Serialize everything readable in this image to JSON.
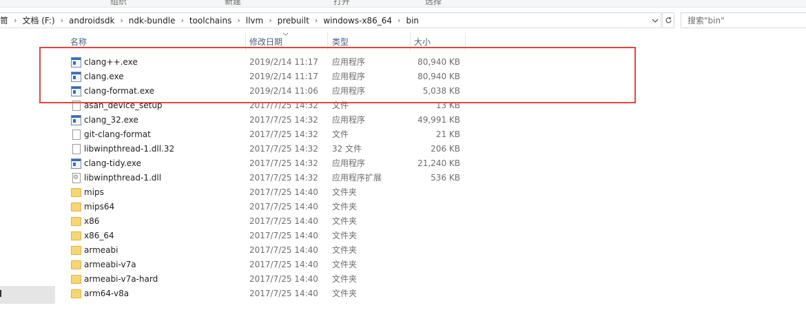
{
  "ribbon": {
    "labels": [
      "组织",
      "新建",
      "打开",
      "选择"
    ]
  },
  "address": {
    "breadcrumbs": [
      "笥",
      "文档 (F:)",
      "androidsdk",
      "ndk-bundle",
      "toolchains",
      "llvm",
      "prebuilt",
      "windows-x86_64",
      "bin"
    ],
    "separator": "›",
    "dropdown_icon": "chevron-down-icon",
    "refresh_icon": "refresh-icon"
  },
  "search": {
    "placeholder": "搜索\"bin\""
  },
  "columns": {
    "name": "名称",
    "date": "修改日期",
    "type": "类型",
    "size": "大小"
  },
  "files": [
    {
      "name": "clang++.exe",
      "date": "2019/2/14 11:17",
      "type": "应用程序",
      "size": "80,940 KB",
      "icon": "exe-icon"
    },
    {
      "name": "clang.exe",
      "date": "2019/2/14 11:17",
      "type": "应用程序",
      "size": "80,940 KB",
      "icon": "exe-icon"
    },
    {
      "name": "clang-format.exe",
      "date": "2019/2/14 11:06",
      "type": "应用程序",
      "size": "5,038 KB",
      "icon": "exe-icon"
    },
    {
      "name": "asan_device_setup",
      "date": "2017/7/25 14:32",
      "type": "文件",
      "size": "13 KB",
      "icon": "file-icon"
    },
    {
      "name": "clang_32.exe",
      "date": "2017/7/25 14:32",
      "type": "应用程序",
      "size": "49,991 KB",
      "icon": "exe-icon"
    },
    {
      "name": "git-clang-format",
      "date": "2017/7/25 14:32",
      "type": "文件",
      "size": "21 KB",
      "icon": "file-icon"
    },
    {
      "name": "libwinpthread-1.dll.32",
      "date": "2017/7/25 14:32",
      "type": "32 文件",
      "size": "206 KB",
      "icon": "file-icon"
    },
    {
      "name": "clang-tidy.exe",
      "date": "2017/7/25 14:32",
      "type": "应用程序",
      "size": "21,240 KB",
      "icon": "exe-icon"
    },
    {
      "name": "libwinpthread-1.dll",
      "date": "2017/7/25 14:32",
      "type": "应用程序扩展",
      "size": "536 KB",
      "icon": "dll-icon"
    },
    {
      "name": "mips",
      "date": "2017/7/25 14:40",
      "type": "文件夹",
      "size": "",
      "icon": "folder-icon"
    },
    {
      "name": "mips64",
      "date": "2017/7/25 14:40",
      "type": "文件夹",
      "size": "",
      "icon": "folder-icon"
    },
    {
      "name": "x86",
      "date": "2017/7/25 14:40",
      "type": "文件夹",
      "size": "",
      "icon": "folder-icon"
    },
    {
      "name": "x86_64",
      "date": "2017/7/25 14:40",
      "type": "文件夹",
      "size": "",
      "icon": "folder-icon"
    },
    {
      "name": "armeabi",
      "date": "2017/7/25 14:40",
      "type": "文件夹",
      "size": "",
      "icon": "folder-icon"
    },
    {
      "name": "armeabi-v7a",
      "date": "2017/7/25 14:40",
      "type": "文件夹",
      "size": "",
      "icon": "folder-icon"
    },
    {
      "name": "armeabi-v7a-hard",
      "date": "2017/7/25 14:40",
      "type": "文件夹",
      "size": "",
      "icon": "folder-icon"
    },
    {
      "name": "arm64-v8a",
      "date": "2017/7/25 14:40",
      "type": "文件夹",
      "size": "",
      "icon": "folder-icon"
    }
  ],
  "highlight": {
    "color": "#e8413b",
    "rows_highlighted": 3
  },
  "colors": {
    "header_text": "#4c607a",
    "meta_text": "#6d6d6d",
    "folder": "#f6d574"
  }
}
